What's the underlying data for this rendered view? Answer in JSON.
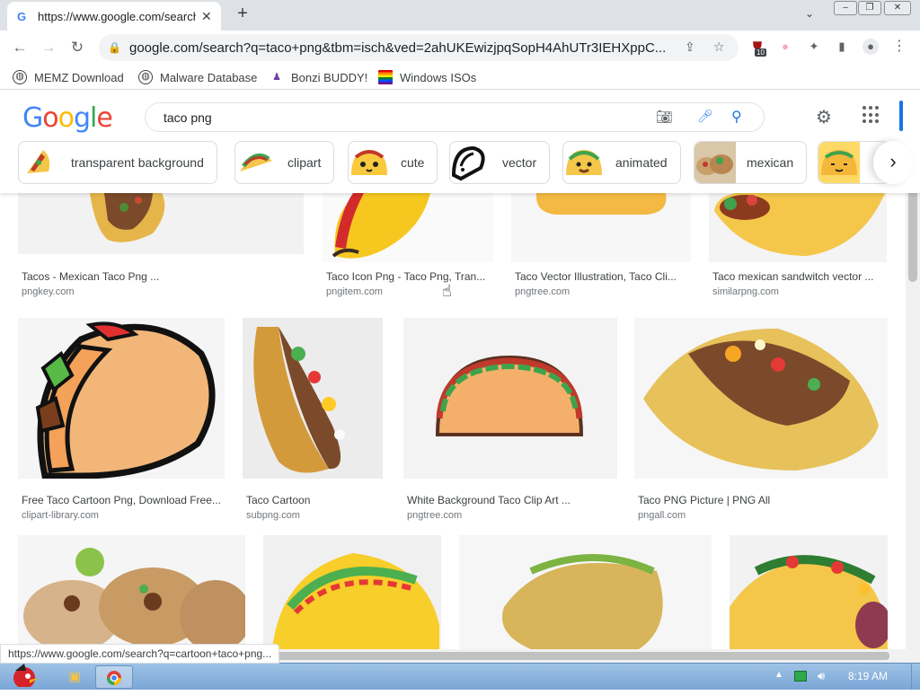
{
  "browser": {
    "tab_title": "https://www.google.com/search?q=taco+png",
    "tab_favicon": "G",
    "url": "google.com/search?q=taco+png&tbm=isch&ved=2ahUKEwizjpqSopH4AhUTr3IEHXppC...",
    "extension_badge": "10"
  },
  "bookmarks": [
    {
      "label": "MEMZ Download",
      "icon": "globe-icon"
    },
    {
      "label": "Malware Database",
      "icon": "globe-icon"
    },
    {
      "label": "Bonzi BUDDY!",
      "icon": "bonzi-icon"
    },
    {
      "label": "Windows ISOs",
      "icon": "windows-flag-icon"
    }
  ],
  "google": {
    "logo": "Google",
    "query": "taco png",
    "chips": [
      "transparent background",
      "clipart",
      "cute",
      "vector",
      "animated",
      "mexican",
      ""
    ]
  },
  "results": [
    {
      "title": "Tacos - Mexican Taco Png ...",
      "site": "pngkey.com"
    },
    {
      "title": "Taco Icon Png - Taco Png, Tran...",
      "site": "pngitem.com"
    },
    {
      "title": "Taco Vector Illustration, Taco Cli...",
      "site": "pngtree.com"
    },
    {
      "title": "Taco mexican sandwitch vector ...",
      "site": "similarpng.com"
    },
    {
      "title": "Free Taco Cartoon Png, Download Free...",
      "site": "clipart-library.com"
    },
    {
      "title": "Taco Cartoon",
      "site": "subpng.com"
    },
    {
      "title": "White Background Taco Clip Art ...",
      "site": "pngtree.com"
    },
    {
      "title": "Taco PNG Picture | PNG All",
      "site": "pngall.com"
    }
  ],
  "status_url": "https://www.google.com/search?q=cartoon+taco+png...",
  "taskbar": {
    "clock": "8:19 AM"
  },
  "colors": {
    "google_blue": "#4285f4",
    "google_red": "#ea4335",
    "google_yellow": "#fbbc05",
    "google_green": "#34a853",
    "taco_shell": "#f4c64a",
    "taskbar": "#8db4e0"
  }
}
